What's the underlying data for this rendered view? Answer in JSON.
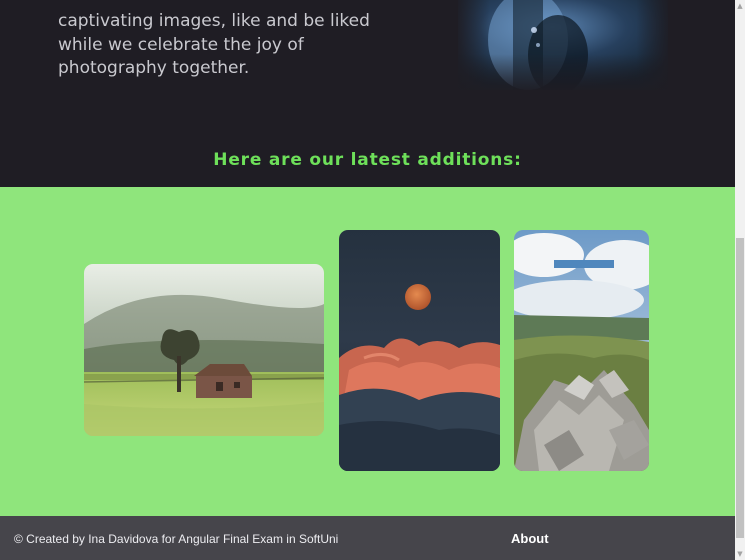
{
  "intro": {
    "lines": [
      "captivating images, like and be liked",
      "while we celebrate the joy of",
      "photography together."
    ]
  },
  "gallery": {
    "heading": "Here are our latest additions:",
    "photos": [
      {
        "subject": "stone cottage with a lone tree in a misty green field"
      },
      {
        "subject": "full orange moon above glowing sunset clouds"
      },
      {
        "subject": "rocky mountain slope above the clouds with a lake"
      }
    ]
  },
  "footer": {
    "credit": "© Created by Ina Davidova for Angular Final Exam in SoftUni",
    "about_label": "About"
  },
  "colors": {
    "page_bg": "#1f1d24",
    "accent_green": "#6ee05a",
    "gallery_bg": "#8fe57c",
    "footer_bg": "#46454b"
  }
}
